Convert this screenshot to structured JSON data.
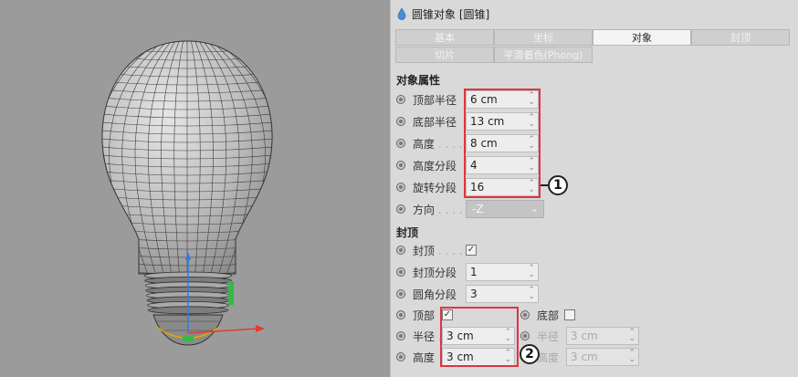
{
  "panel": {
    "title": "圆锥对象 [圆锥]",
    "tabs_row1": [
      "基本",
      "坐标",
      "对象",
      "封顶"
    ],
    "tabs_row2": [
      "切片",
      "平滑着色(Phong)"
    ],
    "active_tab": "对象"
  },
  "object_props": {
    "heading": "对象属性",
    "top_radius": {
      "label": "顶部半径",
      "value": "6 cm"
    },
    "bottom_radius": {
      "label": "底部半径",
      "value": "13 cm"
    },
    "height": {
      "label": "高度",
      "value": "8 cm"
    },
    "height_segments": {
      "label": "高度分段",
      "value": "4"
    },
    "rotation_segments": {
      "label": "旋转分段",
      "value": "16"
    },
    "direction": {
      "label": "方向",
      "value": "-Z"
    }
  },
  "caps": {
    "heading": "封顶",
    "cap": {
      "label": "封顶",
      "checked": true
    },
    "cap_segments": {
      "label": "封顶分段",
      "value": "1"
    },
    "fillet_segments": {
      "label": "圆角分段",
      "value": "3"
    },
    "top": {
      "label": "顶部",
      "checked": true
    },
    "bottom": {
      "label": "底部",
      "checked": false
    },
    "radius": {
      "label": "半径",
      "value": "3 cm"
    },
    "radius_bottom": {
      "label": "半径",
      "value": "3 cm"
    },
    "height": {
      "label": "高度",
      "value": "3 cm"
    },
    "height_bottom": {
      "label": "高度",
      "value": "3 cm"
    }
  },
  "callouts": {
    "one": "1",
    "two": "2"
  },
  "colors": {
    "highlight": "#e0343f",
    "panel_bg": "#d9d9d9",
    "viewport_bg": "#9b9b9b"
  }
}
